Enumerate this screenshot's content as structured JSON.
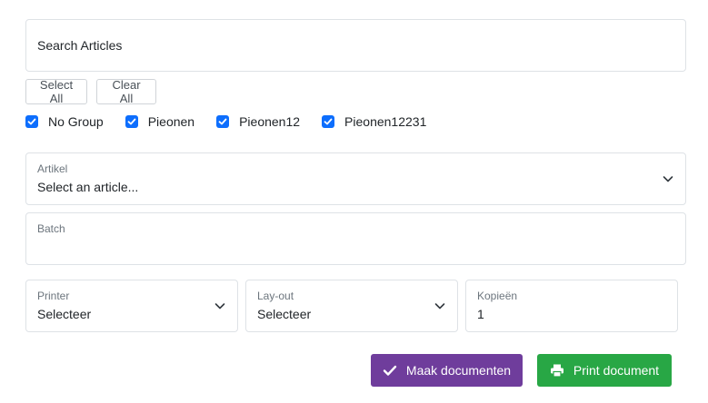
{
  "search": {
    "placeholder": "Search Articles"
  },
  "group_buttons": {
    "select_all": "Select All",
    "clear_all": "Clear All"
  },
  "groups": [
    {
      "label": "No Group",
      "checked": true
    },
    {
      "label": "Pieonen",
      "checked": true
    },
    {
      "label": "Pieonen12",
      "checked": true
    },
    {
      "label": "Pieonen12231",
      "checked": true
    }
  ],
  "artikel": {
    "label": "Artikel",
    "value": "Select an article..."
  },
  "batch": {
    "label": "Batch",
    "value": ""
  },
  "printer": {
    "label": "Printer",
    "value": "Selecteer"
  },
  "layout": {
    "label": "Lay-out",
    "value": "Selecteer"
  },
  "kopieen": {
    "label": "Kopieën",
    "value": "1"
  },
  "actions": {
    "maak": "Maak documenten",
    "print": "Print document"
  },
  "colors": {
    "checkbox": "#0d6efd",
    "maak_button": "#6f3d9c",
    "print_button": "#28a745"
  },
  "icons": {
    "dropdown": "chevron-down-icon",
    "maak": "check-icon",
    "print": "printer-icon"
  }
}
